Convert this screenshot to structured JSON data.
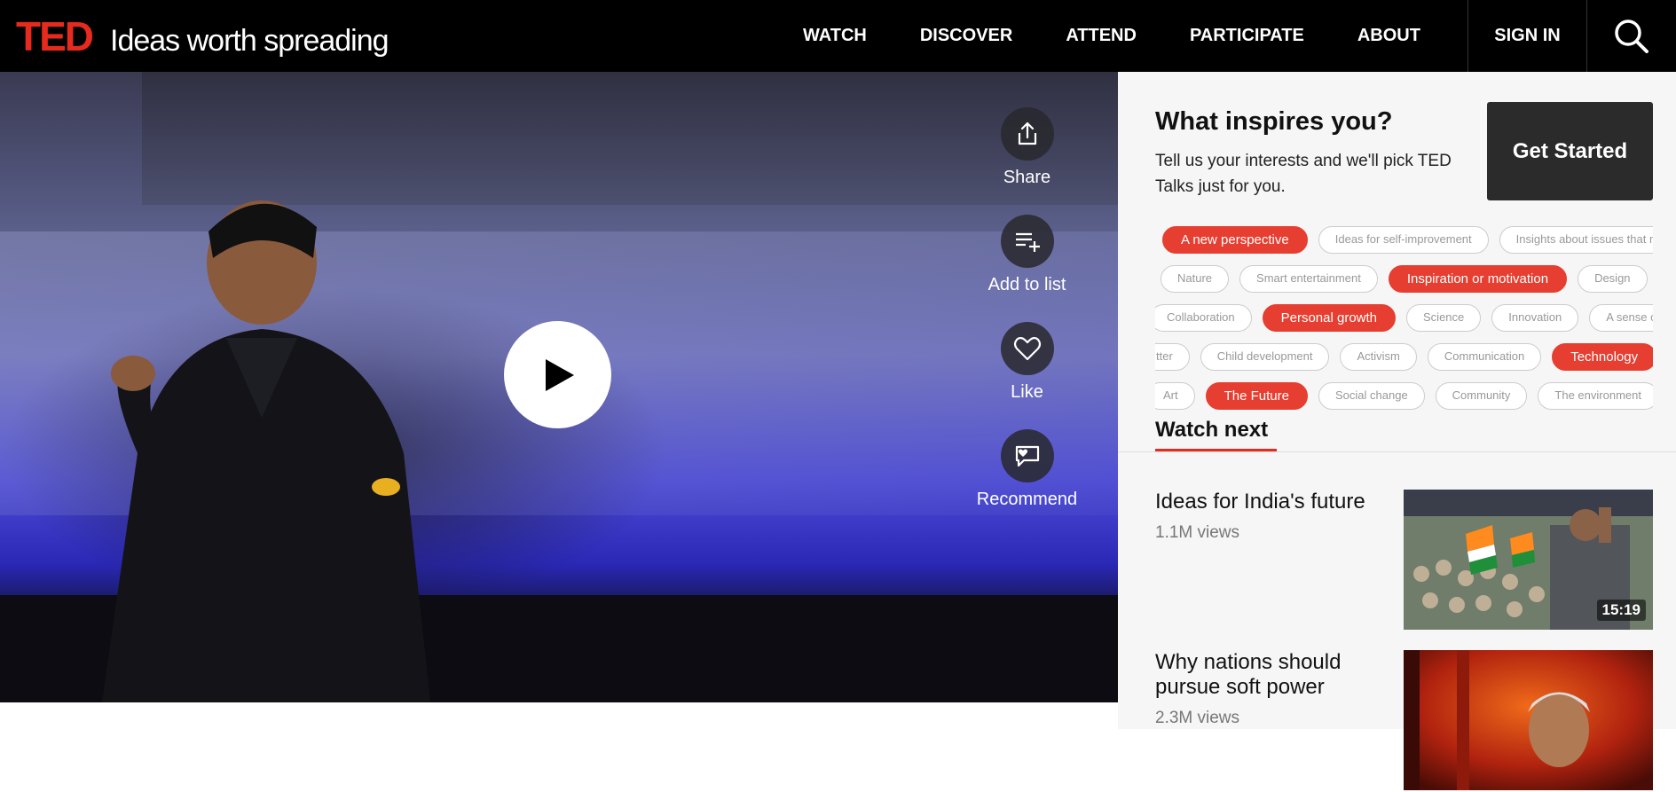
{
  "header": {
    "logo_mark": "TED",
    "logo_tagline": "Ideas worth spreading",
    "nav": [
      "WATCH",
      "DISCOVER",
      "ATTEND",
      "PARTICIPATE",
      "ABOUT"
    ],
    "sign_in": "SIGN IN",
    "search_icon": "search-icon"
  },
  "video": {
    "play_icon": "play-icon",
    "actions": [
      {
        "label": "Share",
        "icon": "share-icon"
      },
      {
        "label": "Add to list",
        "icon": "add-to-list-icon"
      },
      {
        "label": "Like",
        "icon": "heart-icon"
      },
      {
        "label": "Recommend",
        "icon": "recommend-icon"
      }
    ]
  },
  "sidebar": {
    "title": "What inspires you?",
    "description": "Tell us your interests and we'll pick TED Talks just for you.",
    "get_started": "Get Started",
    "tag_rows": [
      [
        {
          "label": "A new perspective",
          "active": true
        },
        {
          "label": "Ideas for self-improvement",
          "active": false
        },
        {
          "label": "Insights about issues that matter",
          "active": false
        }
      ],
      [
        {
          "label": "Nature",
          "active": false
        },
        {
          "label": "Smart entertainment",
          "active": false
        },
        {
          "label": "Inspiration or motivation",
          "active": true
        },
        {
          "label": "Design",
          "active": false
        }
      ],
      [
        {
          "label": "Collaboration",
          "active": false
        },
        {
          "label": "Personal growth",
          "active": true
        },
        {
          "label": "Science",
          "active": false
        },
        {
          "label": "Innovation",
          "active": false
        },
        {
          "label": "A sense of hope",
          "active": false
        }
      ],
      [
        {
          "label": "tter",
          "active": false
        },
        {
          "label": "Child development",
          "active": false
        },
        {
          "label": "Activism",
          "active": false
        },
        {
          "label": "Communication",
          "active": false
        },
        {
          "label": "Technology",
          "active": true
        }
      ],
      [
        {
          "label": "Art",
          "active": false
        },
        {
          "label": "The Future",
          "active": true
        },
        {
          "label": "Social change",
          "active": false
        },
        {
          "label": "Community",
          "active": false
        },
        {
          "label": "The environment",
          "active": false
        }
      ]
    ],
    "watch_next": "Watch next",
    "cards": [
      {
        "title": "Ideas for India's future",
        "views": "1.1M views",
        "duration": "15:19"
      },
      {
        "title": "Why nations should pursue soft power",
        "views": "2.3M views",
        "duration": ""
      }
    ]
  }
}
